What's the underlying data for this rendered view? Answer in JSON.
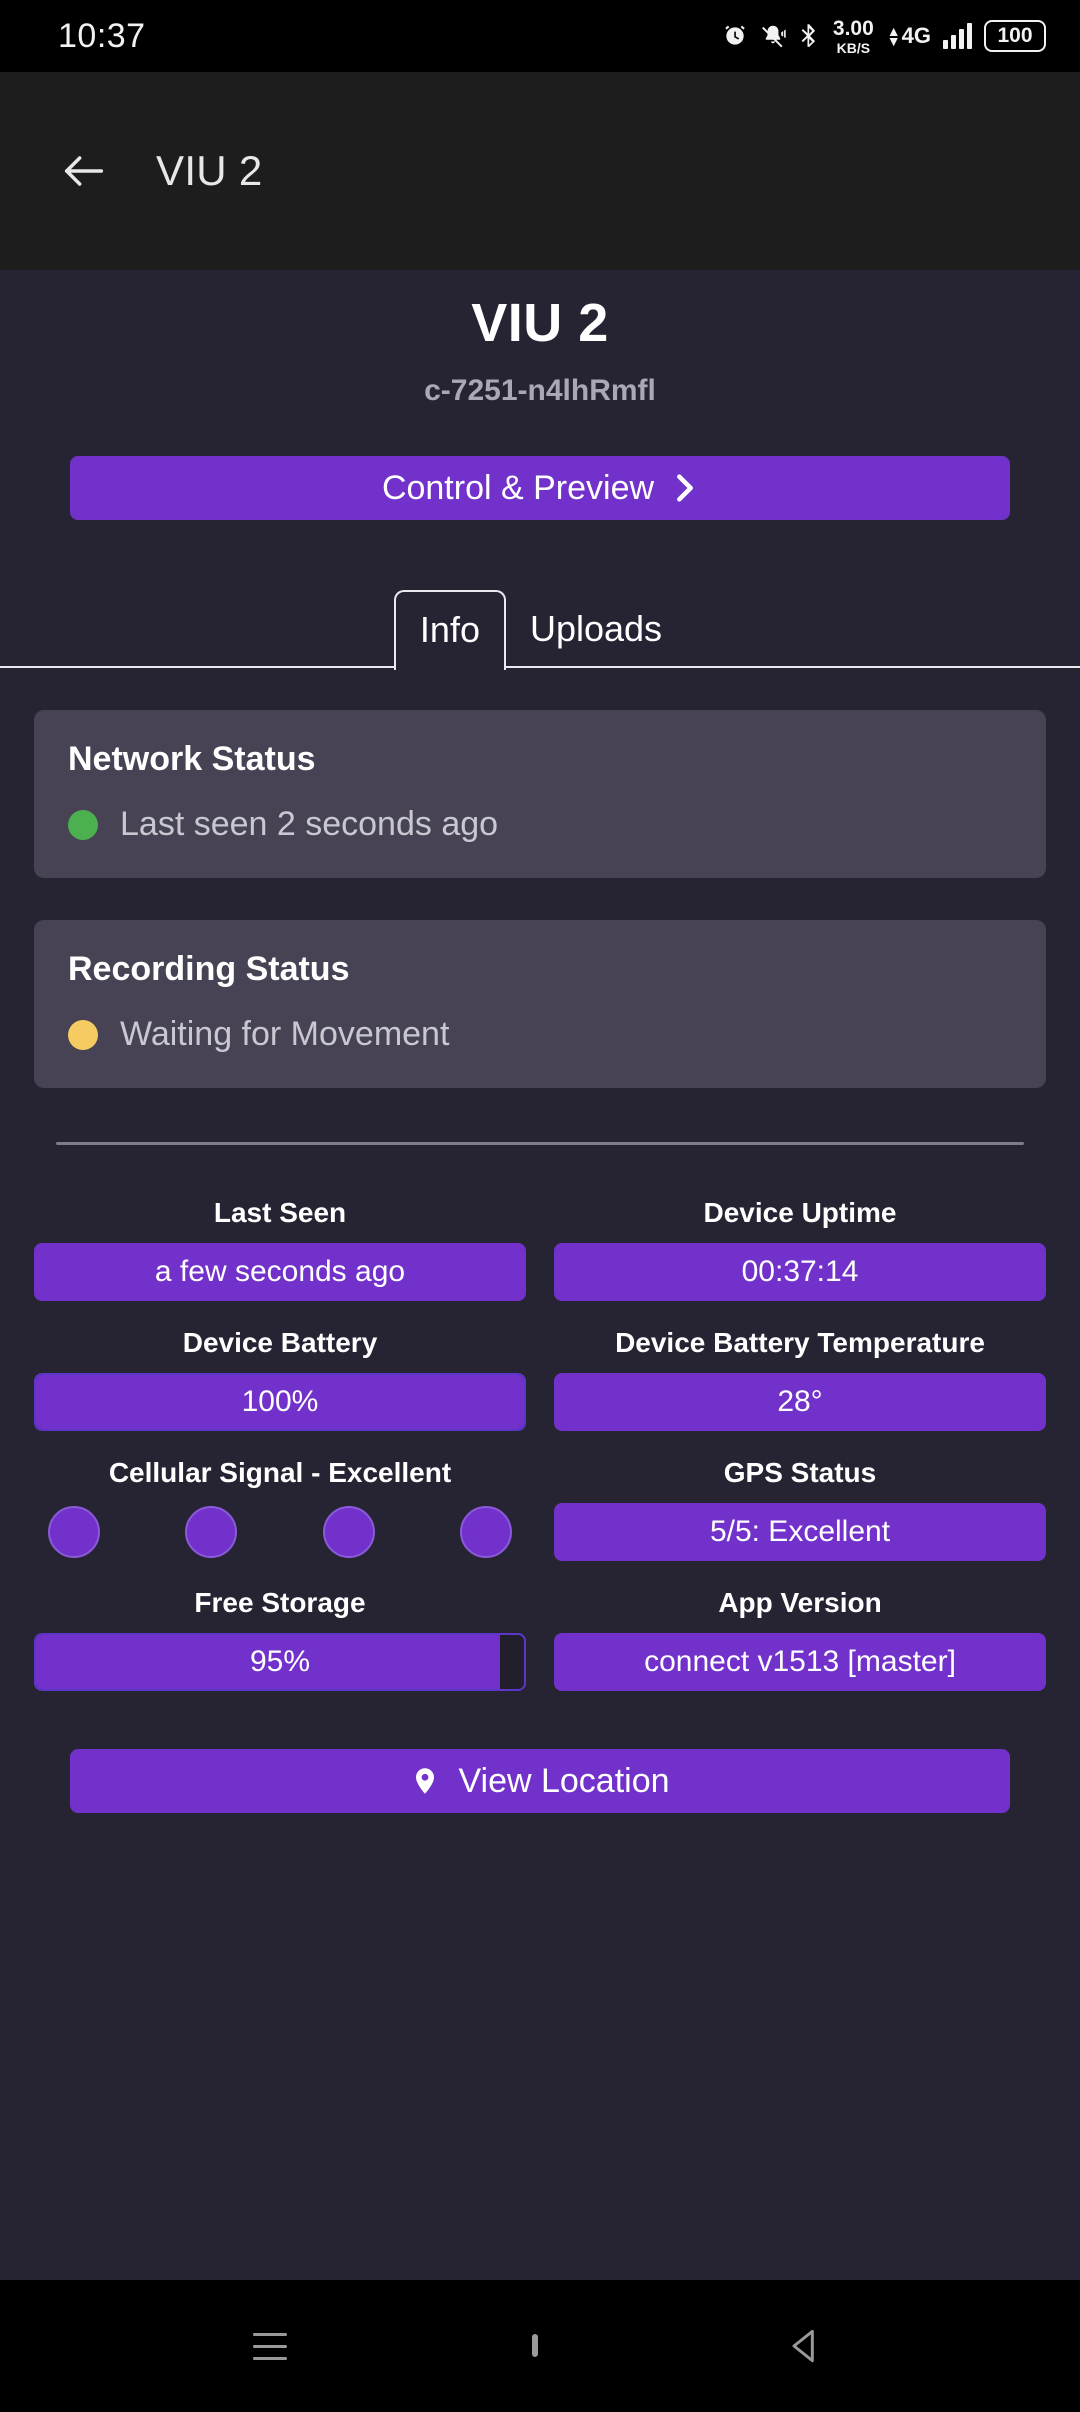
{
  "status_bar": {
    "time": "10:37",
    "icons": [
      "alarm-icon",
      "bell-muted-icon",
      "bluetooth-icon"
    ],
    "net_speed_value": "3.00",
    "net_speed_unit": "KB/S",
    "network_type": "4G",
    "battery_level": "100"
  },
  "app_bar": {
    "back_icon": "arrow-left-icon",
    "title": "VIU 2"
  },
  "device": {
    "name": "VIU 2",
    "id": "c-7251-n4lhRmfl"
  },
  "control_button": {
    "label": "Control & Preview",
    "icon": "chevron-right-icon"
  },
  "tabs": [
    {
      "label": "Info",
      "active": true
    },
    {
      "label": "Uploads",
      "active": false
    }
  ],
  "status_cards": [
    {
      "title": "Network Status",
      "value": "Last seen 2 seconds ago",
      "dot_color": "#4caf50"
    },
    {
      "title": "Recording Status",
      "value": "Waiting for Movement",
      "dot_color": "#f6cc62"
    }
  ],
  "info_items": [
    {
      "label": "Last Seen",
      "value": "a few seconds ago",
      "kind": "chip"
    },
    {
      "label": "Device Uptime",
      "value": "00:37:14",
      "kind": "chip"
    },
    {
      "label": "Device Battery",
      "value": "100%",
      "kind": "meter",
      "percent": 100
    },
    {
      "label": "Device Battery Temperature",
      "value": "28°",
      "kind": "chip"
    },
    {
      "label": "Cellular Signal - Excellent",
      "value": "",
      "kind": "dots",
      "dots": 4
    },
    {
      "label": "GPS Status",
      "value": "5/5: Excellent",
      "kind": "chip"
    },
    {
      "label": "Free Storage",
      "value": "95%",
      "kind": "meter",
      "percent": 95
    },
    {
      "label": "App Version",
      "value": "connect v1513 [master]",
      "kind": "chip"
    }
  ],
  "location_button": {
    "label": "View Location",
    "icon": "map-pin-icon"
  },
  "nav_bar": {
    "recents_icon": "recents-icon",
    "home_icon": "home-icon",
    "back_icon": "back-triangle-icon"
  },
  "colors": {
    "page_bg": "#262433",
    "app_bar_bg": "#1d1d1d",
    "card_bg": "#474254",
    "accent_purple": "#7231cb",
    "meter_border": "#5b36c9",
    "online_green": "#4caf50",
    "waiting_yellow": "#f6cc62"
  }
}
